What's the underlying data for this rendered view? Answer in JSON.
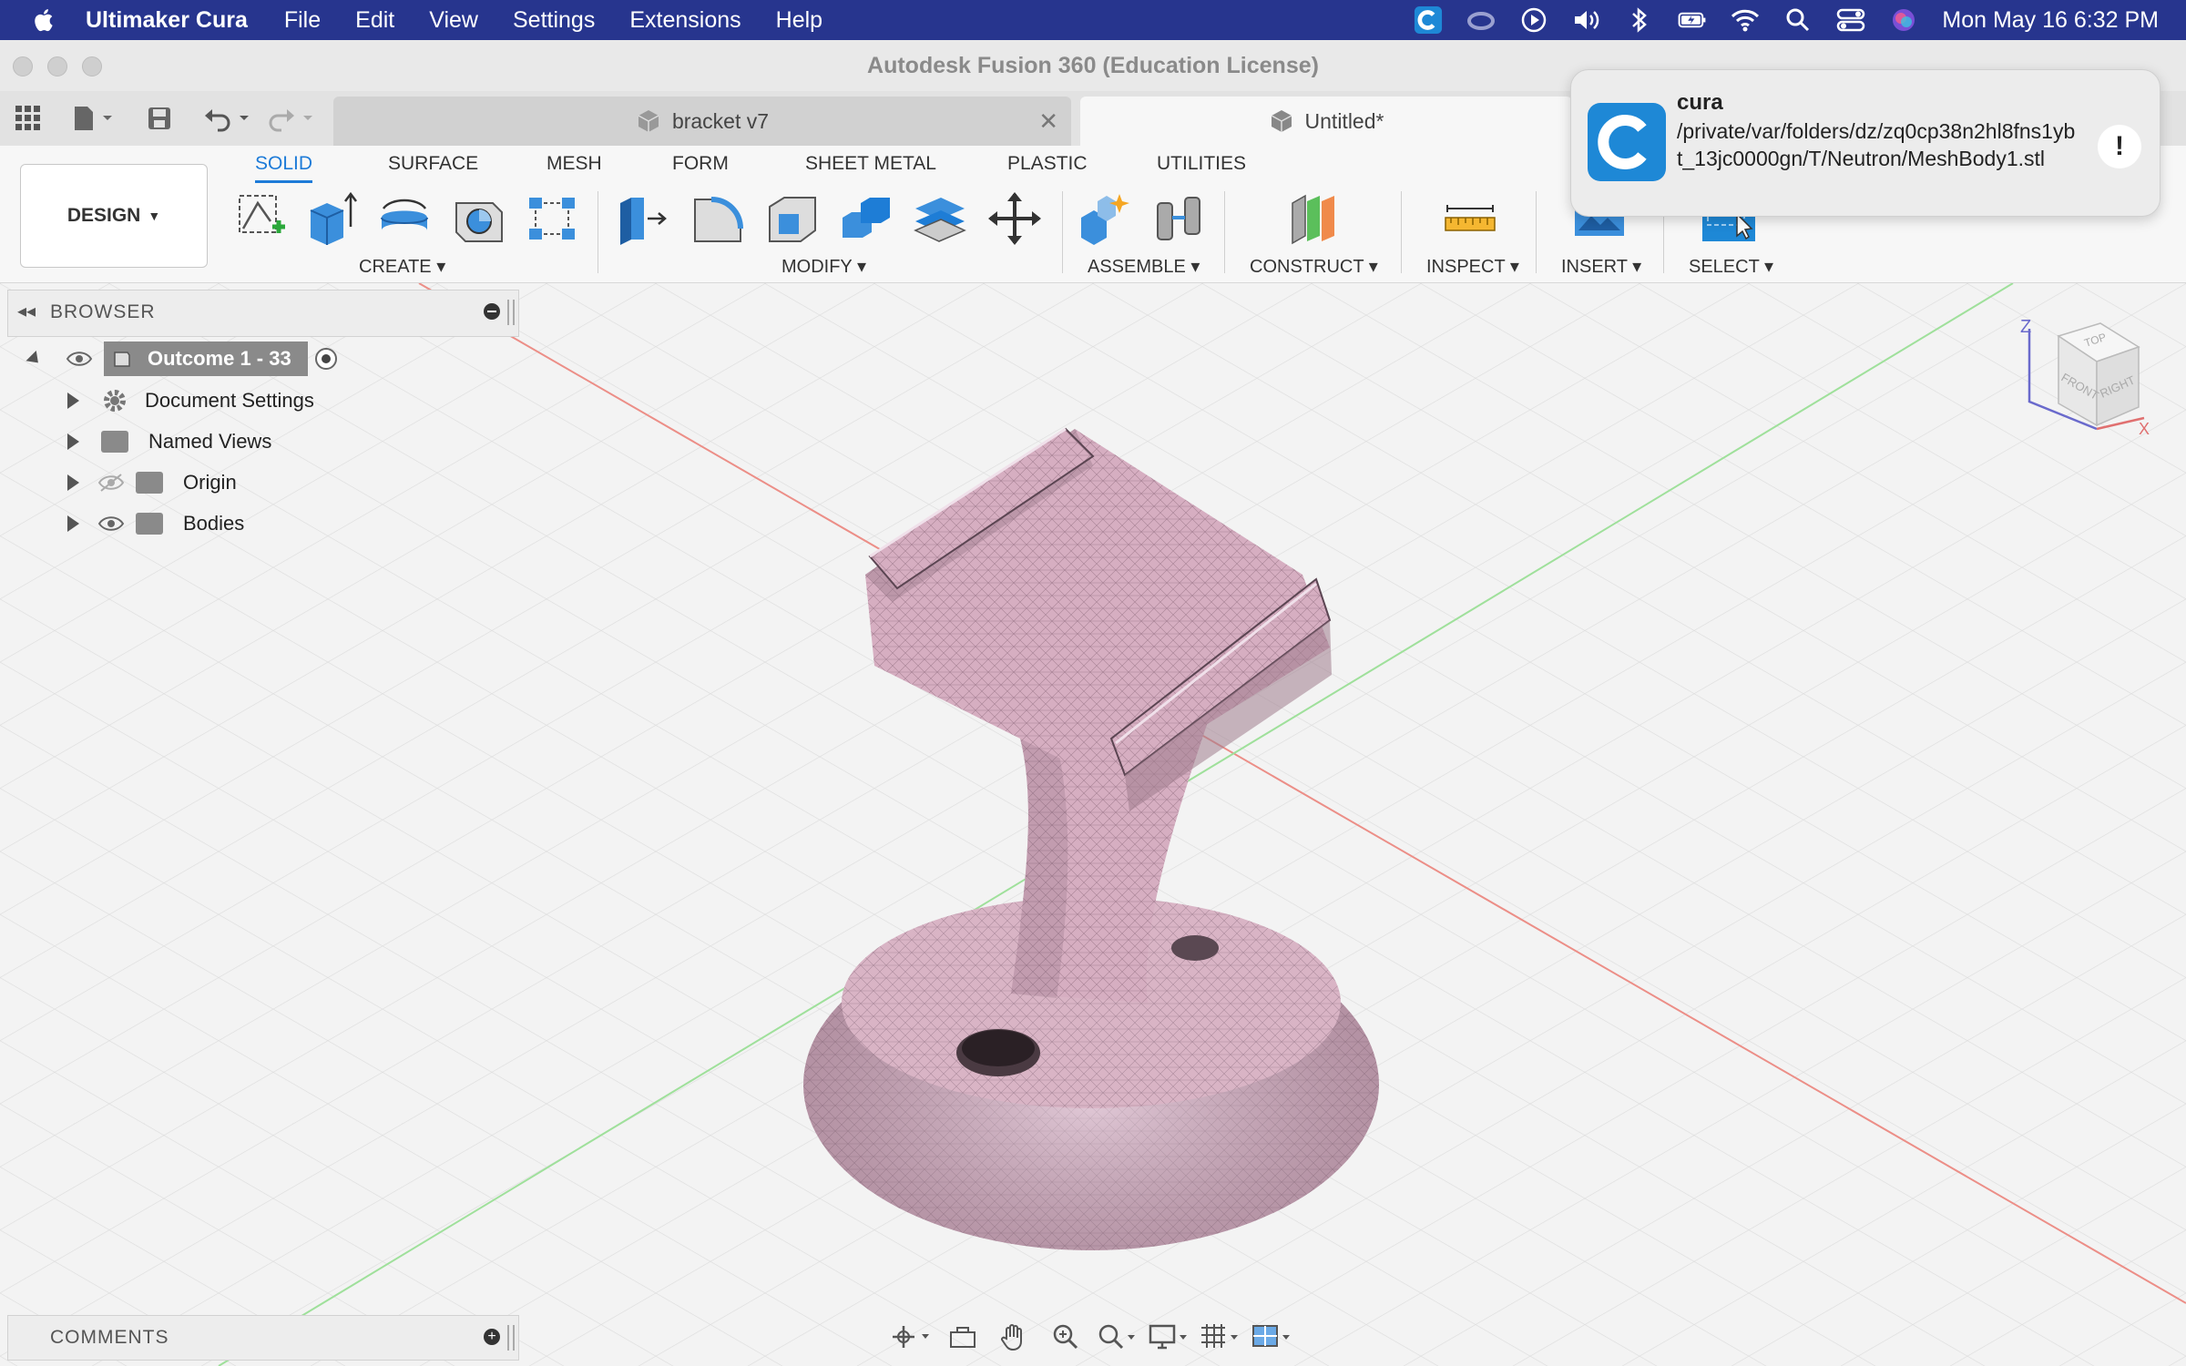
{
  "menubar": {
    "app_name": "Ultimaker Cura",
    "items": [
      "File",
      "Edit",
      "View",
      "Settings",
      "Extensions",
      "Help"
    ],
    "clock": "Mon May 16  6:32 PM",
    "status_icons": [
      "cura-icon",
      "creative-cloud-icon",
      "play-icon",
      "volume-icon",
      "bluetooth-icon",
      "battery-icon",
      "wifi-icon",
      "spotlight-icon",
      "control-center-icon",
      "siri-icon"
    ]
  },
  "window": {
    "title": "Autodesk Fusion 360 (Education License)"
  },
  "tabs": [
    {
      "label": "bracket v7",
      "active": false
    },
    {
      "label": "Untitled*",
      "active": true
    }
  ],
  "toolbar": {
    "workspace": "DESIGN",
    "workspace_tabs": [
      "SOLID",
      "SURFACE",
      "MESH",
      "FORM",
      "SHEET METAL",
      "PLASTIC",
      "UTILITIES"
    ],
    "active_tab": "SOLID",
    "groups": [
      "CREATE",
      "MODIFY",
      "ASSEMBLE",
      "CONSTRUCT",
      "INSPECT",
      "INSERT",
      "SELECT"
    ]
  },
  "notification": {
    "app": "cura",
    "message": "/private/var/folders/dz/zq0cp38n2hl8fns1ybt_13jc0000gn/T/Neutron/MeshBody1.stl",
    "button": "!"
  },
  "browser": {
    "title": "BROWSER",
    "root": "Outcome 1 - 33",
    "items": [
      {
        "label": "Document Settings",
        "icon": "gear-icon"
      },
      {
        "label": "Named Views",
        "icon": "folder-icon"
      },
      {
        "label": "Origin",
        "icon": "folder-icon",
        "visibility": "hidden"
      },
      {
        "label": "Bodies",
        "icon": "folder-icon",
        "visibility": "visible"
      }
    ]
  },
  "comments": {
    "title": "COMMENTS"
  },
  "viewcube": {
    "faces": [
      "TOP",
      "FRONT",
      "RIGHT"
    ],
    "axes": [
      "Z",
      "X"
    ]
  },
  "colors": {
    "menubar": "#27358e",
    "accent": "#1d7bd8",
    "mesh": "#d4a9bd",
    "axis_red": "#e77a74",
    "axis_green": "#8fd88b"
  }
}
